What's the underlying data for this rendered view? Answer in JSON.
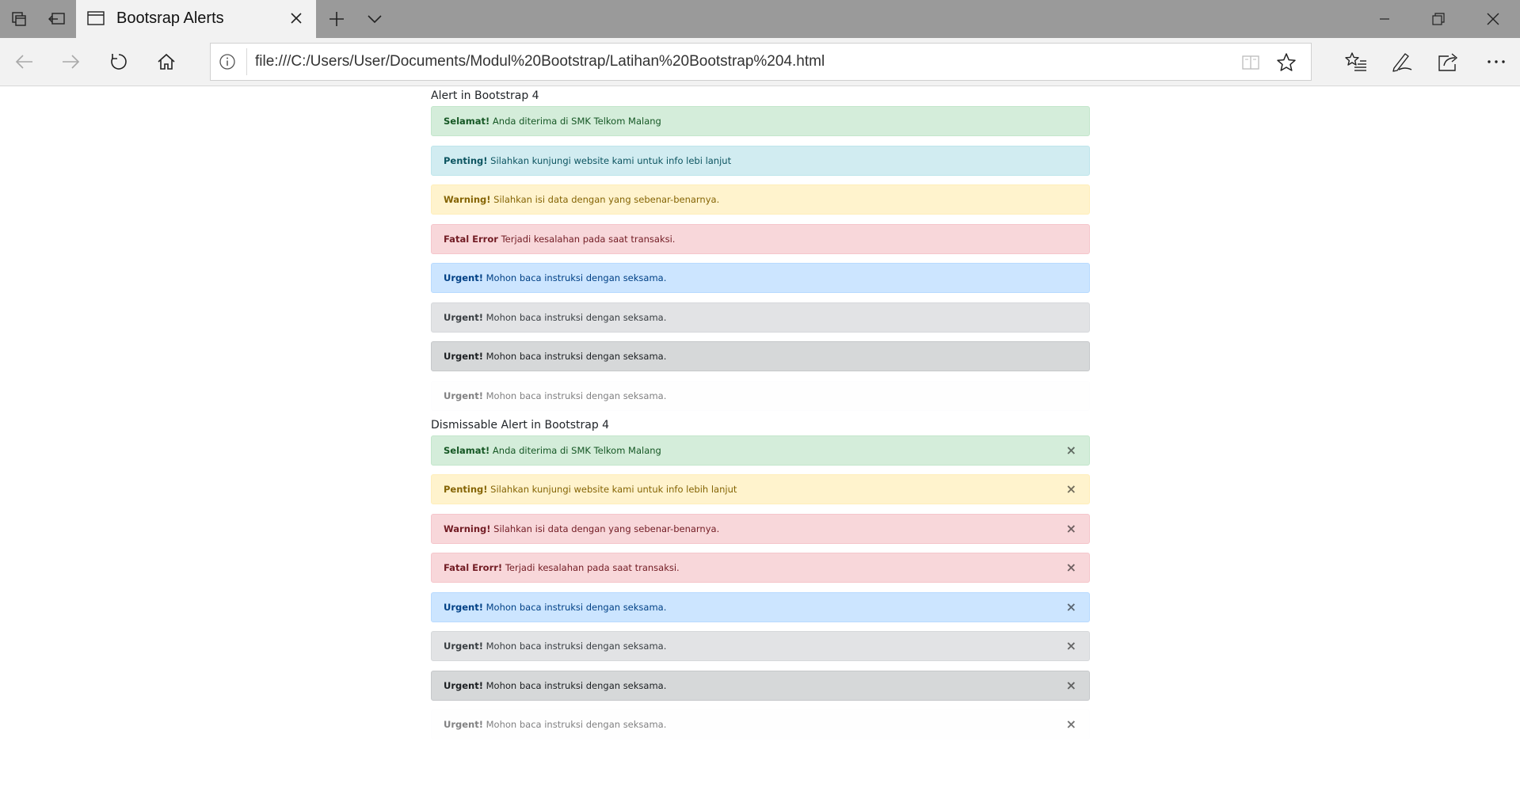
{
  "browser": {
    "tab_title": "Bootsrap Alerts",
    "url": "file:///C:/Users/User/Documents/Modul%20Bootstrap/Latihan%20Bootstrap%204.html"
  },
  "sections": [
    {
      "title": "Alert in Bootstrap 4",
      "alerts": [
        {
          "variant": "success",
          "strong": "Selamat!",
          "text": " Anda diterima di SMK Telkom Malang"
        },
        {
          "variant": "info",
          "strong": "Penting!",
          "text": " Silahkan kunjungi website kami untuk info lebi lanjut"
        },
        {
          "variant": "warning",
          "strong": "Warning!",
          "text": " Silahkan isi data dengan yang sebenar-benarnya."
        },
        {
          "variant": "danger",
          "strong": "Fatal Error",
          "text": " Terjadi kesalahan pada saat transaksi."
        },
        {
          "variant": "primary",
          "strong": "Urgent!",
          "text": " Mohon baca instruksi dengan seksama."
        },
        {
          "variant": "secondary",
          "strong": "Urgent!",
          "text": " Mohon baca instruksi dengan seksama."
        },
        {
          "variant": "dark",
          "strong": "Urgent!",
          "text": " Mohon baca instruksi dengan seksama."
        },
        {
          "variant": "light",
          "strong": "Urgent!",
          "text": " Mohon baca instruksi dengan seksama."
        }
      ]
    },
    {
      "title": "Dismissable Alert in Bootstrap 4",
      "close_symbol": "×",
      "alerts": [
        {
          "variant": "success",
          "strong": "Selamat!",
          "text": " Anda diterima di SMK Telkom Malang"
        },
        {
          "variant": "warning",
          "strong": "Penting!",
          "text": " Silahkan kunjungi website kami untuk info lebih lanjut"
        },
        {
          "variant": "danger",
          "strong": "Warning!",
          "text": " Silahkan isi data dengan yang sebenar-benarnya."
        },
        {
          "variant": "danger",
          "strong": "Fatal Erorr!",
          "text": " Terjadi kesalahan pada saat transaksi."
        },
        {
          "variant": "primary",
          "strong": "Urgent!",
          "text": " Mohon baca instruksi dengan seksama."
        },
        {
          "variant": "secondary",
          "strong": "Urgent!",
          "text": " Mohon baca instruksi dengan seksama."
        },
        {
          "variant": "dark",
          "strong": "Urgent!",
          "text": " Mohon baca instruksi dengan seksama."
        },
        {
          "variant": "light",
          "strong": "Urgent!",
          "text": " Mohon baca instruksi dengan seksama."
        }
      ]
    }
  ],
  "icons": {
    "tab_manager": "tab-manager-icon",
    "set_aside": "set-aside-tabs-icon",
    "back": "back-arrow-icon",
    "forward": "forward-arrow-icon",
    "refresh": "refresh-icon",
    "home": "home-icon",
    "info": "info-icon",
    "reading_view": "reading-view-icon",
    "favorite": "star-icon",
    "favorites_hub": "favorites-hub-icon",
    "web_note": "pen-icon",
    "share": "share-icon",
    "more": "more-icon"
  },
  "colors": {
    "tabbar": "#9a9a9a",
    "chrome": "#f2f2f2"
  }
}
